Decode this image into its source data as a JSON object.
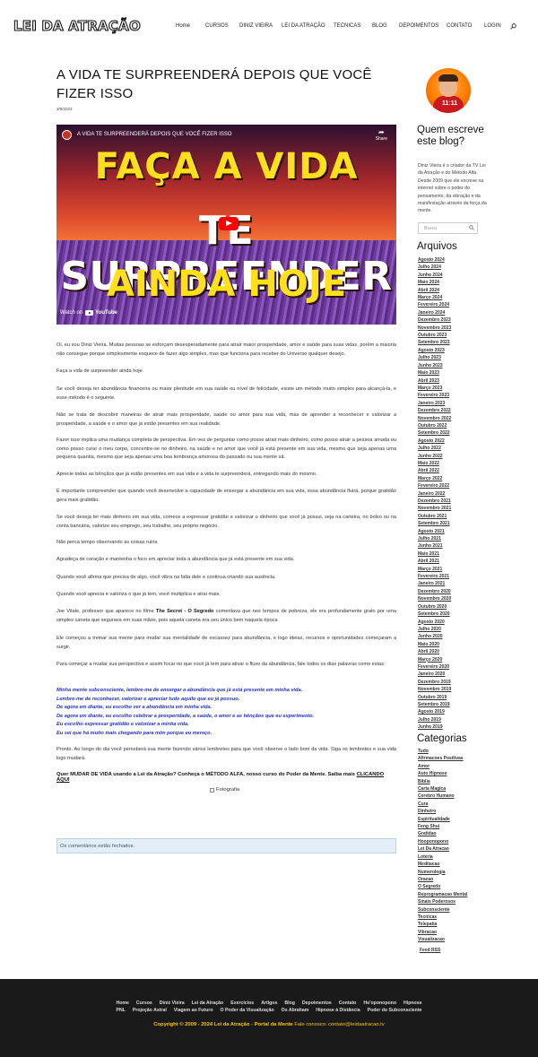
{
  "header": {
    "logo": "LEI DA ATRAÇÃO",
    "nav": [
      "Home",
      "CURSOS",
      "DINIZ VIEIRA",
      "LEI DA ATRAÇÃO",
      "TECNICAS",
      "BLOG",
      "DEPOIMENTOS",
      "CONTATO",
      "LOGIN"
    ]
  },
  "post": {
    "title": "A VIDA TE SURPREENDERÁ DEPOIS QUE VOCÊ FIZER ISSO",
    "date": "3/9/2023",
    "video": {
      "title": "A VIDA TE SURPREENDERÁ DEPOIS QUE VOCÊ FIZER ISSO",
      "line1": "FAÇA A VIDA",
      "line2": "TE SURPREENDER",
      "line3": "AINDA HOJE",
      "share": "Share",
      "watch_on": "Watch on",
      "youtube": "YouTube"
    },
    "paragraphs": [
      "Oi, eu sou Diniz Vieira. Muitas pessoas se esforçam desesperadamente para atrair maior prosperidade, amor e saúde para suas vidas, porém a maioria não consegue porque simplesmente esquece de fazer algo simples, mas que funciona para receber do Universo qualquer desejo.",
      "Faça a vida de surpreender ainda hoje.",
      "Se você deseja ter abundância financeira ou maior plenitude em sua saúde ou nível de felicidade, existe um método muito simples para alcançá-la, e esse método é o seguinte.",
      "Não se trata de descobrir maneiras de atrair mais prosperidade, saúde ou amor para sua vida, mas de aprender a reconhecer e valorizar a prosperidade, a saúde e o amor que já estão presentes em sua realidade.",
      "Fazer isso implica uma mudança completa de perspectiva. Em vez de perguntar como posso atrair mais dinheiro, como posso atrair a pessoa amada ou como posso curar o meu corpo, concentre-se no dinheiro, na saúde e no amor que você já está presente em sua vida, mesmo que seja apenas uma pequena quantia, mesmo que seja apenas uma boa lembrança amorosa do passado ou sua mente sã.",
      "Aprecie todas as bênçãos que já estão presentes em sua vida e a vida te surpreenderá, entregando mais do mesmo.",
      "É importante compreender que quando você desenvolve a capacidade de enxergar a abundância em sua vida, essa abundância fluirá, porque gratidão gera mais gratidão.",
      "Se você deseja ter mais dinheiro em sua vida, comece a expressar gratidão e valorizar o dinheiro que você já possui, seja na carteira, no bolso ou na conta bancária, valorize seu emprego, seu trabalho, seu próprio negócio.",
      "Não perca tempo observando as coisas ruins.",
      "Agradeça de coração e mantenha o foco em apreciar toda a abundância que já está presente em sua vida.",
      "Quando você afirma que precisa de algo, você vibra na falta dele e continua criando sua ausência.",
      "Quando você aprecia e valoriza o que já tem, você multiplica e atrai mais.",
      "Joe Vitale, professor que aparece no filme The Secret - O Segredo comentava que nos tempos de pobreza, ele era profundamente grato por uma simples caneta que segurava em suas mãos, pois aquela caneta era seu único bem naquela época",
      "Ele começou a treinar sua mente para mudar sua mentalidade de escassez para abundância, e logo ideias, recursos e oportunidades começaram a surgir.",
      "Para começar a mudar sua perspectiva e assim focar no que você já tem para ativar o fluxo da abundância, fale todos os dias palavras como estas:"
    ],
    "bold_phrase": "The Secret - O Segredo",
    "affirmations": [
      "Minha mente subconsciente, lembre-me de enxergar a abundância que já está presente em minha vida.",
      "Lembre-me de reconhecer, valorizar e apreciar tudo aquilo que eu já possuo.",
      "De agora em diante, eu escolho ver a abundância em minha vida.",
      "De agora em diante, eu escolho celebrar a prosperidade, a saúde, o amor e as bênçãos que eu experimento.",
      "Eu escolho expressar gratidão e valorizar a minha vida.",
      "Eu sei que há muito mais chegando para mim porque eu mereço."
    ],
    "closing": "Pronto. Ao longo do dia você perceberá sua mente fazendo vários lembretes para que você observe o lado bom da vida. Siga os lembretes e sua vida logo mudará.",
    "cta_text": "Quer MUDAR DE VIDA usando a Lei da Atração? Conheça o MÉTODO ALFA, nosso curso do Poder da Mente. Saiba mais ",
    "cta_link": "CLICANDO AQUI",
    "image_alt": "Fotografia",
    "comments_closed": "Os comentários estão fechados."
  },
  "sidebar": {
    "avatar_number": "11:11",
    "about_title": "Quem escreve este blog?",
    "about_text": "Diniz Vieira é o criador da TV Lei da Atração e do Método Alfa. Desde 2009 que ele escreve na internet sobre o poder do pensamento, da vibração e da manifestação através da força da mente.",
    "search_placeholder": "Busca",
    "archives_title": "Arquivos",
    "archives": [
      "Agosto 2024",
      "Julho 2024",
      "Junho 2024",
      "Maio 2024",
      "Abril 2024",
      "Março 2024",
      "Fevereiro 2024",
      "Janeiro 2024",
      "Dezembro 2023",
      "Novembro 2023",
      "Outubro 2023",
      "Setembro 2023",
      "Agosto 2023",
      "Julho 2023",
      "Junho 2023",
      "Maio 2023",
      "Abril 2023",
      "Março 2023",
      "Fevereiro 2023",
      "Janeiro 2023",
      "Dezembro 2022",
      "Novembro 2022",
      "Outubro 2022",
      "Setembro 2022",
      "Agosto 2022",
      "Julho 2022",
      "Junho 2022",
      "Maio 2022",
      "Abril 2022",
      "Março 2022",
      "Fevereiro 2022",
      "Janeiro 2022",
      "Dezembro 2021",
      "Novembro 2021",
      "Outubro 2021",
      "Setembro 2021",
      "Agosto 2021",
      "Julho 2021",
      "Junho 2021",
      "Maio 2021",
      "Abril 2021",
      "Março 2021",
      "Fevereiro 2021",
      "Janeiro 2021",
      "Dezembro 2020",
      "Novembro 2020",
      "Outubro 2020",
      "Setembro 2020",
      "Agosto 2020",
      "Julho 2020",
      "Junho 2020",
      "Maio 2020",
      "Abril 2020",
      "Março 2020",
      "Fevereiro 2020",
      "Janeiro 2020",
      "Dezembro 2019",
      "Novembro 2019",
      "Outubro 2019",
      "Setembro 2019",
      "Agosto 2019",
      "Julho 2019",
      "Junho 2019"
    ],
    "categories_title": "Categorias",
    "categories": [
      "Tudo",
      "Afirmacoes Positivas",
      "Amor",
      "Auto Hipnose",
      "Biblia",
      "Carta Magica",
      "Cerebro Humano",
      "Cura",
      "Dinheiro",
      "Espiritualidade",
      "Feng Shui",
      "Gratidao",
      "Hooponopono",
      "Lei Da Atracao",
      "Loteria",
      "Meditacao",
      "Numerologia",
      "Oracao",
      "O Segredo",
      "Reprogramacao Mental",
      "Sinais Poderosos",
      "Subconsciente",
      "Tecnicas",
      "Telepatia",
      "Vibracao",
      "Visualizacao"
    ],
    "feed": "Feed RSS"
  },
  "footer": {
    "row1": [
      "Home",
      "Cursos",
      "Diniz Vieira",
      "Lei da Atração",
      "Exercícios",
      "Artigos",
      "Blog",
      "Depoimentos",
      "Contato",
      "Ho'oponopono",
      "Hipnose"
    ],
    "row2": [
      "PNL",
      "Projeção Astral",
      "Viagem ao Futuro",
      "O Poder da Visualização",
      "Os Abraham",
      "Hipnose à Distância",
      "Poder do Subconsciente"
    ],
    "copyright": "Copyright © 2009 - 2024 Lei da Atração - Portal da Mente",
    "contact": " Fale conosco: contato@leidaatracao.tv"
  }
}
